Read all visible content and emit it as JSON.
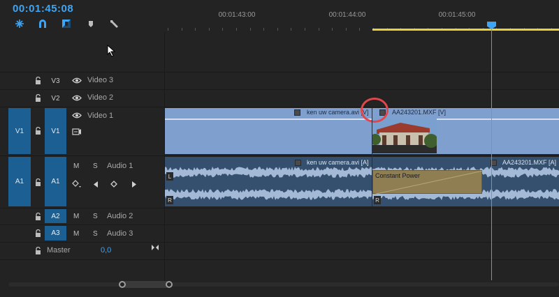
{
  "timeline": {
    "timecode": "00:01:45:08",
    "ruler_labels": [
      "00:01:43:00",
      "00:01:44:00",
      "00:01:45:00"
    ]
  },
  "toolbar": {
    "tools": [
      "snap-icon",
      "linked-selection-icon",
      "add-marker-icon",
      "marker-icon",
      "wrench-icon"
    ]
  },
  "tracks": {
    "video": [
      {
        "source": "",
        "target": "V3",
        "name": "Video 3"
      },
      {
        "source": "",
        "target": "V2",
        "name": "Video 2"
      },
      {
        "source": "V1",
        "target": "V1",
        "name": "Video 1"
      }
    ],
    "audio": [
      {
        "source": "A1",
        "target": "A1",
        "name": "Audio 1",
        "m": "M",
        "s": "S"
      },
      {
        "source": "",
        "target": "A2",
        "name": "Audio 2",
        "m": "M",
        "s": "S"
      },
      {
        "source": "",
        "target": "A3",
        "name": "Audio 3",
        "m": "M",
        "s": "S"
      }
    ],
    "master": {
      "name": "Master",
      "value": "0,0"
    }
  },
  "clips": {
    "video1_a": "ken uw camera.avi [V]",
    "video1_b": "AA243201.MXF [V]",
    "audio1_a": "ken uw camera.avi [A]",
    "audio1_b": "AA243201.MXF [A]",
    "transition": "Constant Power",
    "channel_left": "L",
    "channel_right": "R"
  },
  "colors": {
    "accent": "#3ea5f4",
    "work_area": "#e8d23b",
    "video_clip": "#7f9fcf",
    "audio_clip": "#35506f",
    "track_target": "#1b5f93",
    "transition": "#8e7e52",
    "highlight_ring": "#e0474c"
  }
}
